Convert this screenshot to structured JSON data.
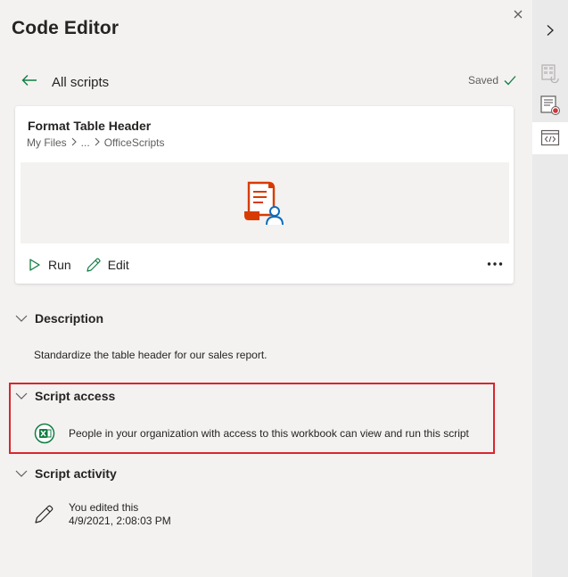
{
  "panel": {
    "title": "Code Editor",
    "close_icon": "close-icon"
  },
  "nav": {
    "back_icon": "arrow-left-icon",
    "label": "All scripts",
    "saved_label": "Saved",
    "saved_icon": "checkmark-icon"
  },
  "script": {
    "name": "Format Table Header",
    "breadcrumb": [
      "My Files",
      "...",
      "OfficeScripts"
    ],
    "thumbnail_icon": "script-user-icon",
    "run_label": "Run",
    "edit_label": "Edit",
    "more_icon": "more-icon"
  },
  "description": {
    "heading": "Description",
    "text": "Standardize the table header for our sales report."
  },
  "access": {
    "heading": "Script access",
    "icon": "excel-icon",
    "text": "People in your organization with access to this workbook can view and run this script"
  },
  "activity": {
    "heading": "Script activity",
    "icon": "pencil-icon",
    "line1": "You edited this",
    "line2": "4/9/2021, 2:08:03 PM"
  },
  "rail": {
    "items": [
      "chevron-right-icon",
      "layout-sync-icon",
      "script-record-icon",
      "code-editor-icon"
    ],
    "active": "code-editor-icon"
  },
  "colors": {
    "accent_green": "#107c41",
    "highlight_red": "#d9262c",
    "script_orange": "#d83b01",
    "script_blue": "#0f6cbd"
  }
}
